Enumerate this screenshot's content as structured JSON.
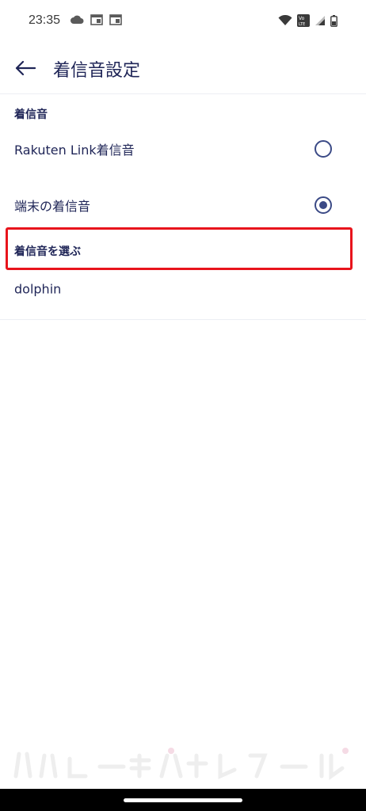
{
  "status_bar": {
    "time": "23:35",
    "left_icons": [
      "cloud-icon",
      "calendar-icon",
      "calendar-icon"
    ],
    "right_icons": [
      "wifi-icon",
      "volte-icon",
      "signal-icon",
      "battery-icon"
    ],
    "volte_text_top": "Vo",
    "volte_text_bottom": "LTE"
  },
  "app_bar": {
    "back_icon": "arrow-left-icon",
    "title": "着信音設定"
  },
  "ringtone_section": {
    "header": "着信音",
    "options": [
      {
        "label": "Rakuten Link着信音",
        "selected": false
      },
      {
        "label": "端末の着信音",
        "selected": true
      }
    ]
  },
  "choose_section": {
    "header": "着信音を選ぶ",
    "current_ringtone": "dolphin"
  },
  "colors": {
    "text": "#1f2557",
    "radio": "#3b4a86",
    "highlight": "#e8141c",
    "divider": "#eceef3"
  }
}
